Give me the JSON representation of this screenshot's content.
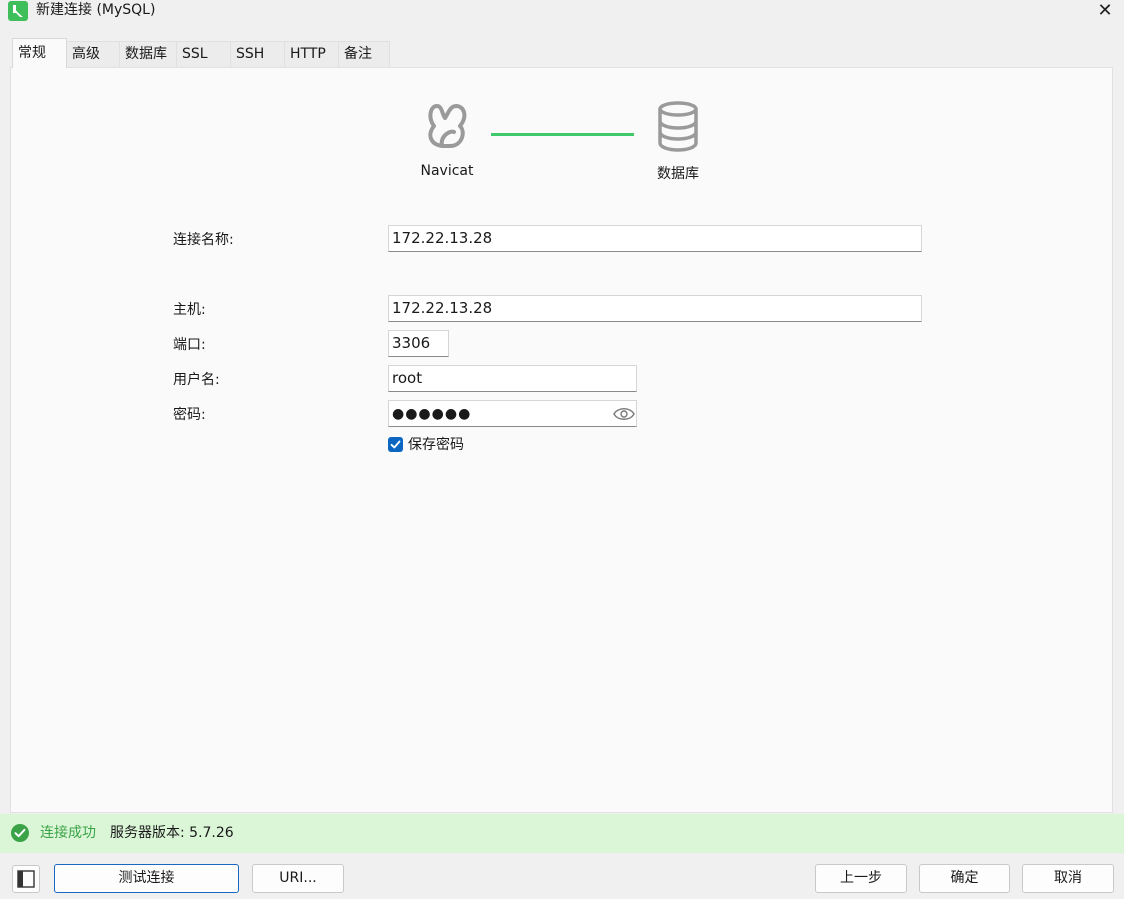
{
  "window": {
    "title": "新建连接 (MySQL)",
    "close_label": "✕"
  },
  "tabs": [
    {
      "label": "常规",
      "active": true
    },
    {
      "label": "高级"
    },
    {
      "label": "数据库"
    },
    {
      "label": "SSL"
    },
    {
      "label": "SSH"
    },
    {
      "label": "HTTP"
    },
    {
      "label": "备注"
    }
  ],
  "diagram": {
    "left_label": "Navicat",
    "right_label": "数据库",
    "line_color": "#3fc96a"
  },
  "form": {
    "connection_name_label": "连接名称:",
    "connection_name_value": "172.22.13.28",
    "host_label": "主机:",
    "host_value": "172.22.13.28",
    "port_label": "端口:",
    "port_value": "3306",
    "username_label": "用户名:",
    "username_value": "root",
    "password_label": "密码:",
    "password_masked": "●●●●●●",
    "save_password_label": "保存密码",
    "save_password_checked": true
  },
  "status": {
    "success_text": "连接成功",
    "version_text": "服务器版本: 5.7.26",
    "success_color": "#3aa347",
    "bar_color": "#dbf6d7"
  },
  "buttons": {
    "test_connection": "测试连接",
    "uri": "URI...",
    "previous": "上一步",
    "ok": "确定",
    "cancel": "取消"
  },
  "icons": {
    "app": "navicat-logo-icon",
    "close": "close-icon",
    "navicat": "navicat-icon",
    "database": "database-icon",
    "eye": "eye-icon",
    "checkbox": "check-icon",
    "status": "check-circle-icon",
    "sidebar_toggle": "sidebar-toggle-icon"
  }
}
